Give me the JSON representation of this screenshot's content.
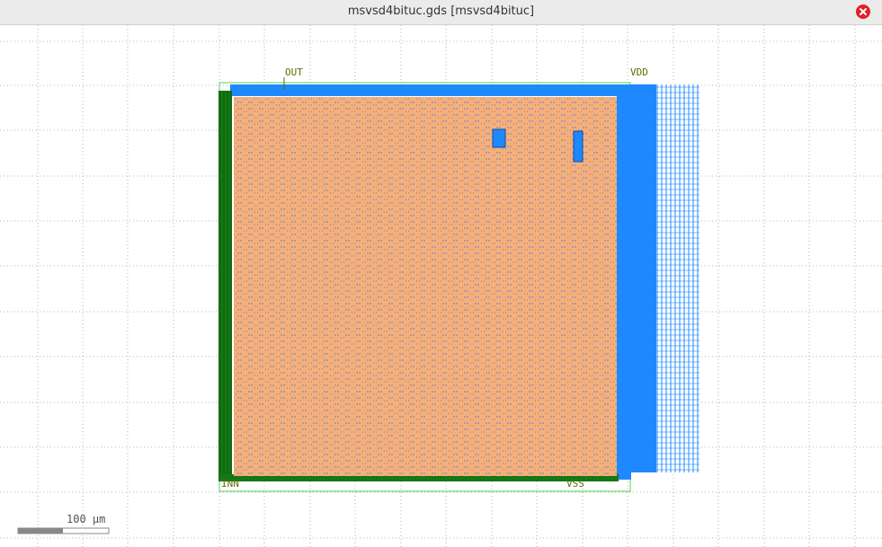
{
  "window": {
    "title": "msvsd4bituc.gds [msvsd4bituc]"
  },
  "icons": {
    "close": "close-icon"
  },
  "layout_view": {
    "pins": {
      "out": "OUT",
      "vdd": "VDD",
      "inn": "INN",
      "vss": "VSS"
    },
    "scale_bar": {
      "label": "100 µm"
    }
  },
  "colors": {
    "grid_dots": "#b4b4b4",
    "metal_blue": "#1e88ff",
    "poly_green": "#147814",
    "boundary_green": "#50d050",
    "core_orange": "#f2b07d",
    "pin_text": "#5c6e00",
    "close_red": "#e0202a"
  }
}
